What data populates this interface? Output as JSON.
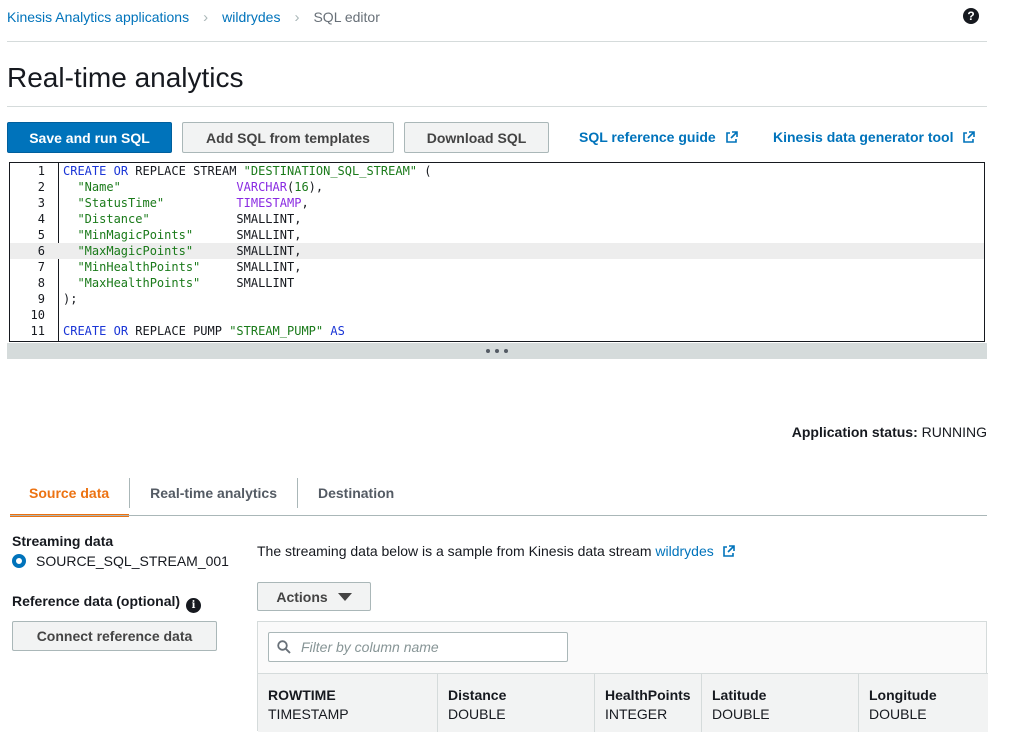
{
  "breadcrumb": {
    "items": [
      "Kinesis Analytics applications",
      "wildrydes",
      "SQL editor"
    ]
  },
  "page_title": "Real-time analytics",
  "toolbar": {
    "save_run": "Save and run SQL",
    "add_templates": "Add SQL from templates",
    "download": "Download SQL",
    "sql_reference": "SQL reference guide",
    "data_generator": "Kinesis data generator tool"
  },
  "editor": {
    "active_line": 6,
    "lines": [
      {
        "n": "1",
        "tokens": [
          [
            "kw",
            "CREATE"
          ],
          [
            "p",
            " "
          ],
          [
            "kw",
            "OR"
          ],
          [
            "p",
            " REPLACE STREAM "
          ],
          [
            "str",
            "\"DESTINATION_SQL_STREAM\""
          ],
          [
            "p",
            " ("
          ]
        ]
      },
      {
        "n": "2",
        "tokens": [
          [
            "p",
            "  "
          ],
          [
            "str",
            "\"Name\""
          ],
          [
            "p",
            "                "
          ],
          [
            "typ",
            "VARCHAR"
          ],
          [
            "p",
            "("
          ],
          [
            "num",
            "16"
          ],
          [
            "p",
            "),"
          ]
        ]
      },
      {
        "n": "3",
        "tokens": [
          [
            "p",
            "  "
          ],
          [
            "str",
            "\"StatusTime\""
          ],
          [
            "p",
            "          "
          ],
          [
            "typ",
            "TIMESTAMP"
          ],
          [
            "p",
            ","
          ]
        ]
      },
      {
        "n": "4",
        "tokens": [
          [
            "p",
            "  "
          ],
          [
            "str",
            "\"Distance\""
          ],
          [
            "p",
            "            SMALLINT,"
          ]
        ]
      },
      {
        "n": "5",
        "tokens": [
          [
            "p",
            "  "
          ],
          [
            "str",
            "\"MinMagicPoints\""
          ],
          [
            "p",
            "      SMALLINT,"
          ]
        ]
      },
      {
        "n": "6",
        "tokens": [
          [
            "p",
            "  "
          ],
          [
            "str",
            "\"MaxMagicPoints\""
          ],
          [
            "p",
            "      SMALLINT,"
          ]
        ]
      },
      {
        "n": "7",
        "tokens": [
          [
            "p",
            "  "
          ],
          [
            "str",
            "\"MinHealthPoints\""
          ],
          [
            "p",
            "     SMALLINT,"
          ]
        ]
      },
      {
        "n": "8",
        "tokens": [
          [
            "p",
            "  "
          ],
          [
            "str",
            "\"MaxHealthPoints\""
          ],
          [
            "p",
            "     SMALLINT"
          ]
        ]
      },
      {
        "n": "9",
        "tokens": [
          [
            "p",
            ");"
          ]
        ]
      },
      {
        "n": "10",
        "tokens": []
      },
      {
        "n": "11",
        "tokens": [
          [
            "kw",
            "CREATE"
          ],
          [
            "p",
            " "
          ],
          [
            "kw",
            "OR"
          ],
          [
            "p",
            " REPLACE PUMP "
          ],
          [
            "str",
            "\"STREAM_PUMP\""
          ],
          [
            "p",
            " "
          ],
          [
            "kw",
            "AS"
          ]
        ]
      }
    ]
  },
  "status": {
    "label": "Application status:",
    "value": "RUNNING"
  },
  "tabs": [
    "Source data",
    "Real-time analytics",
    "Destination"
  ],
  "source": {
    "streaming_label": "Streaming data",
    "stream_name": "SOURCE_SQL_STREAM_001",
    "reference_label": "Reference data (optional)",
    "connect_button": "Connect reference data",
    "description": "The streaming data below is a sample from Kinesis data stream",
    "stream_link": "wildrydes",
    "actions_button": "Actions",
    "filter_placeholder": "Filter by column name",
    "columns": [
      {
        "name": "ROWTIME",
        "type": "TIMESTAMP"
      },
      {
        "name": "Distance",
        "type": "DOUBLE"
      },
      {
        "name": "HealthPoints",
        "type": "INTEGER"
      },
      {
        "name": "Latitude",
        "type": "DOUBLE"
      },
      {
        "name": "Longitude",
        "type": "DOUBLE"
      }
    ]
  },
  "colors": {
    "link": "#0073bb",
    "primary_button": "#0073bb",
    "active_tab": "#ec7211"
  }
}
